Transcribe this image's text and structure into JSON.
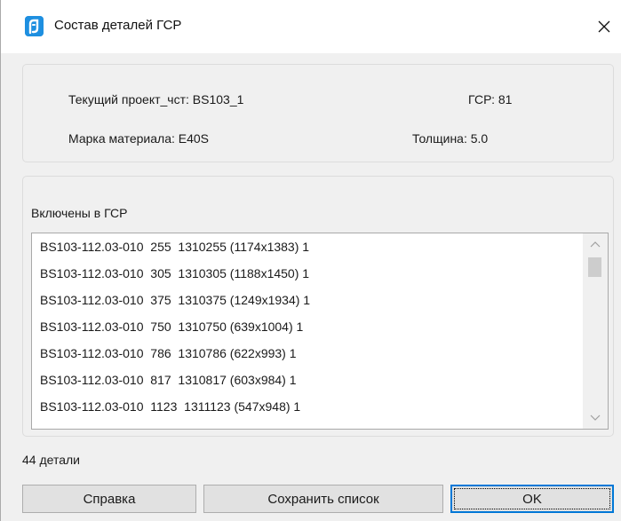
{
  "window": {
    "title": "Состав деталей ГСР",
    "icon": "app-icon",
    "close_icon": "close-icon"
  },
  "info": {
    "project_label": "Текущий проект_чст: BS103_1",
    "gsr_label": "ГСР: 81",
    "material_label": "Марка материала: E40S",
    "thickness_label": "Толщина: 5.0"
  },
  "included": {
    "heading": "Включены в ГСР",
    "items": [
      "BS103-112.03-010  255  1310255 (1174x1383) 1",
      "BS103-112.03-010  305  1310305 (1188x1450) 1",
      "BS103-112.03-010  375  1310375 (1249x1934) 1",
      "BS103-112.03-010  750  1310750 (639x1004) 1",
      "BS103-112.03-010  786  1310786 (622x993) 1",
      "BS103-112.03-010  817  1310817 (603x984) 1",
      "BS103-112.03-010  1123  1311123 (547x948) 1"
    ]
  },
  "footer": {
    "count_text": "44 детали",
    "help_label": "Справка",
    "save_label": "Сохранить список",
    "ok_label": "OK"
  },
  "colors": {
    "accent": "#0078d7",
    "icon_blue": "#1e8fe0",
    "dialog_bg": "#f0f0f0",
    "button_bg": "#e1e1e1"
  }
}
